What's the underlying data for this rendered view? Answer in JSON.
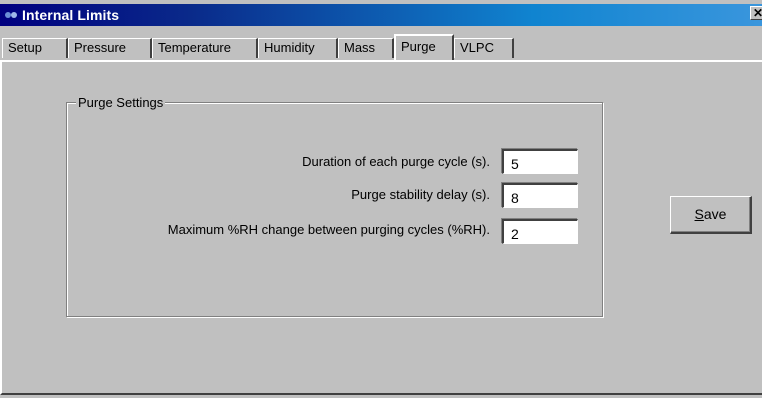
{
  "window": {
    "title": "Internal Limits",
    "close_glyph": "✕",
    "icon": "app-icon"
  },
  "tabs": [
    {
      "label": "Setup",
      "active": false
    },
    {
      "label": "Pressure",
      "active": false
    },
    {
      "label": "Temperature",
      "active": false
    },
    {
      "label": "Humidity",
      "active": false
    },
    {
      "label": "Mass",
      "active": false
    },
    {
      "label": "Purge",
      "active": true
    },
    {
      "label": "VLPC",
      "active": false
    }
  ],
  "group": {
    "title": "Purge Settings",
    "rows": [
      {
        "label": "Duration of each purge cycle (s).",
        "value": "5"
      },
      {
        "label": "Purge stability delay (s).",
        "value": "8"
      },
      {
        "label": "Maximum %RH change between purging cycles (%RH).",
        "value": "2"
      }
    ]
  },
  "actions": {
    "save_accel": "S",
    "save_rest": "ave"
  },
  "colors": {
    "face": "#c0c0c0",
    "title_start": "#000080",
    "title_end": "#3a96dd"
  }
}
